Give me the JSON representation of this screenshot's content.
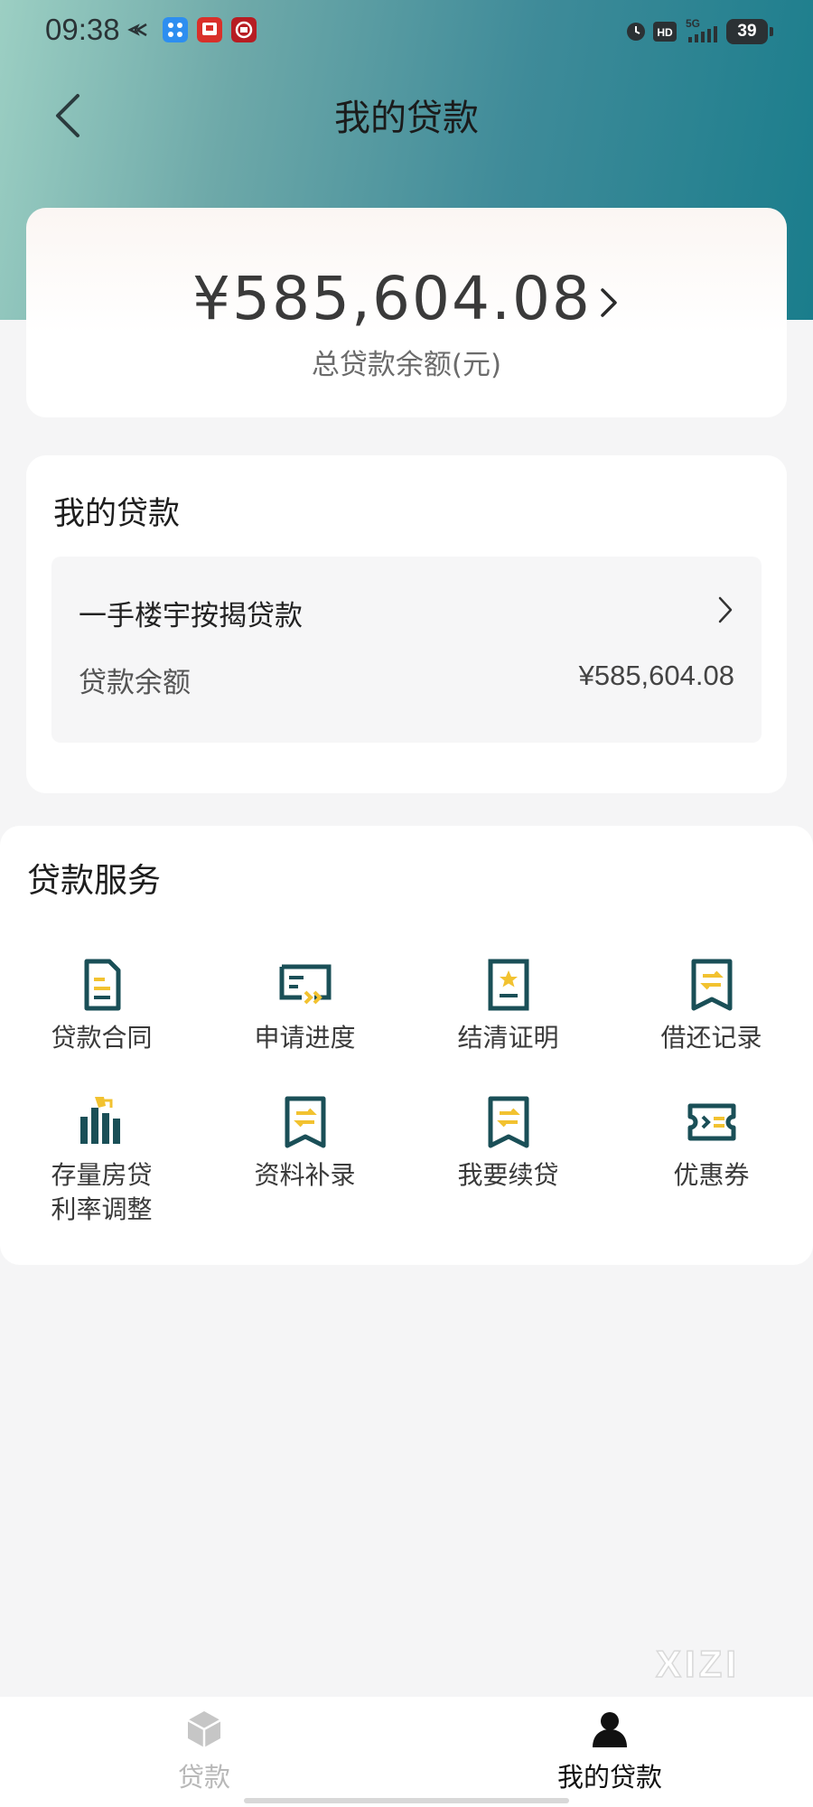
{
  "status_bar": {
    "time": "09:38",
    "network": "5G",
    "battery": "39"
  },
  "nav": {
    "title": "我的贷款"
  },
  "summary": {
    "total_amount": "¥585,604.08",
    "total_label": "总贷款余额(元)"
  },
  "my_loans": {
    "title": "我的贷款",
    "items": [
      {
        "name": "一手楼宇按揭贷款",
        "balance_label": "贷款余额",
        "balance_value": "¥585,604.08"
      }
    ]
  },
  "services": {
    "title": "贷款服务",
    "items": [
      {
        "label": "贷款合同",
        "icon": "contract-icon"
      },
      {
        "label": "申请进度",
        "icon": "progress-icon"
      },
      {
        "label": "结清证明",
        "icon": "certificate-icon"
      },
      {
        "label": "借还记录",
        "icon": "records-icon"
      },
      {
        "label": "存量房贷",
        "label2": "利率调整",
        "icon": "rate-chart-icon"
      },
      {
        "label": "资料补录",
        "icon": "supplement-icon"
      },
      {
        "label": "我要续贷",
        "icon": "renew-icon"
      },
      {
        "label": "优惠券",
        "icon": "coupon-icon"
      }
    ]
  },
  "watermark": "XIZI",
  "bottom_nav": {
    "tabs": [
      {
        "label": "贷款",
        "icon": "cube-icon",
        "active": false
      },
      {
        "label": "我的贷款",
        "icon": "person-icon",
        "active": true
      }
    ]
  },
  "colors": {
    "accent_teal": "#1a4f57",
    "accent_yellow": "#f2c230",
    "active_tab": "#111111",
    "inactive_tab": "#b8b8b8"
  }
}
